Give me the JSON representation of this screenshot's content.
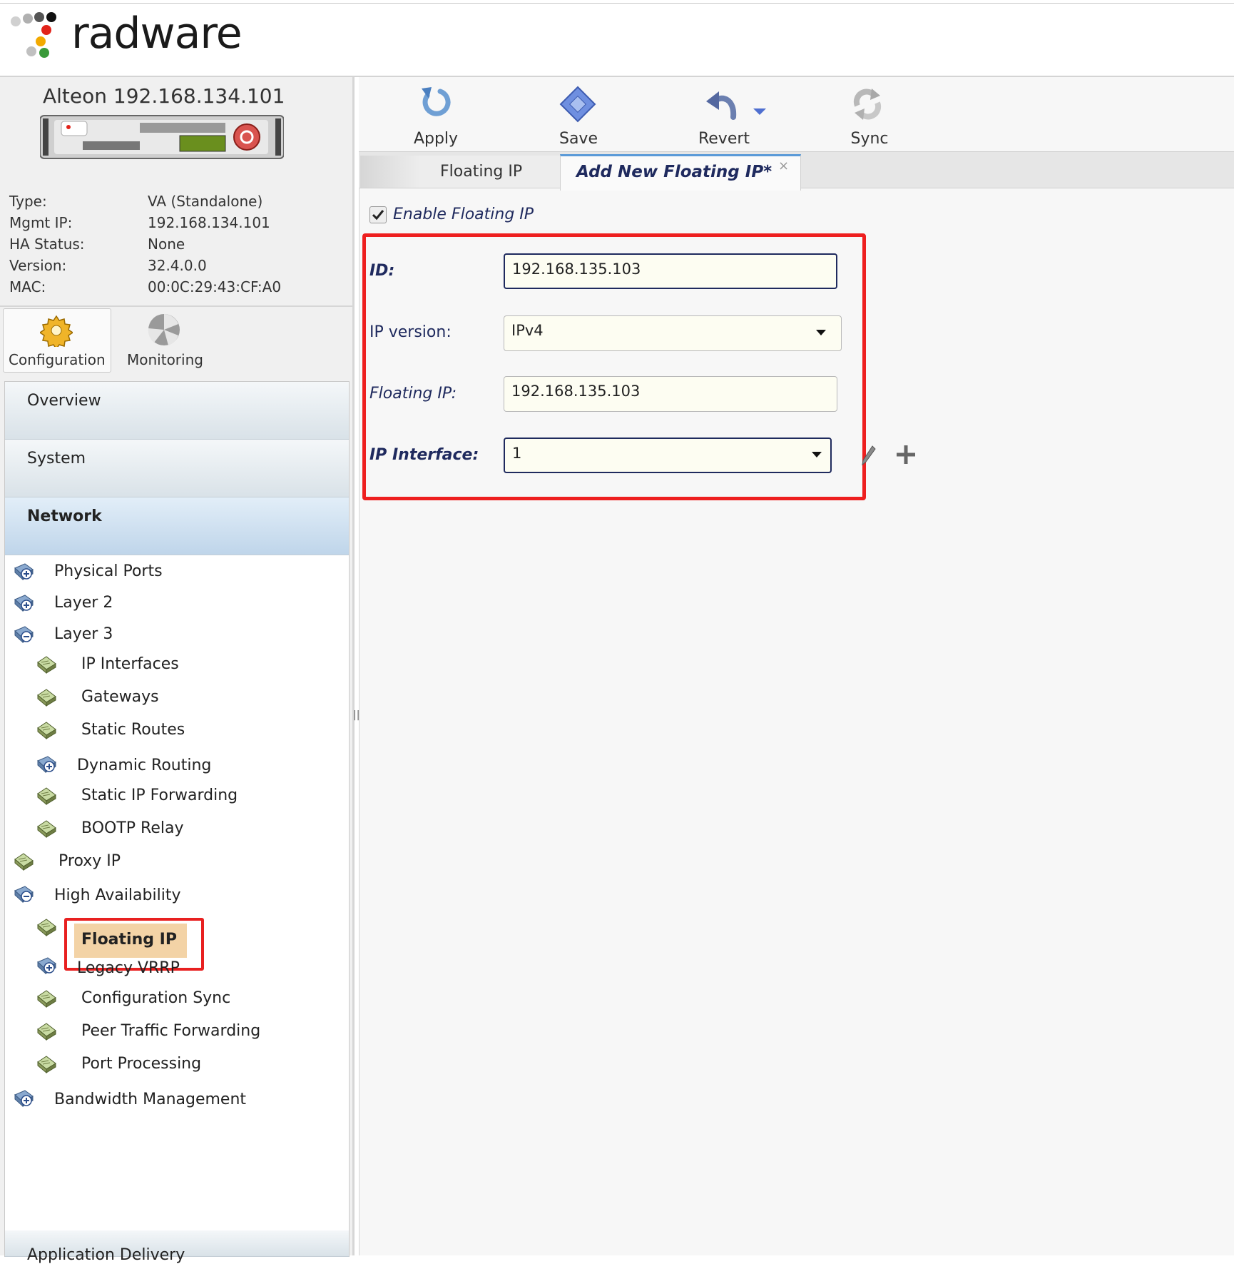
{
  "brand": {
    "logo_text": "radware"
  },
  "device": {
    "title": "Alteon 192.168.134.101",
    "info": [
      {
        "label": "Type:",
        "value": "VA (Standalone)"
      },
      {
        "label": "Mgmt IP:",
        "value": "192.168.134.101"
      },
      {
        "label": "HA Status:",
        "value": "None"
      },
      {
        "label": "Version:",
        "value": "32.4.0.0"
      },
      {
        "label": "MAC:",
        "value": "00:0C:29:43:CF:A0"
      }
    ]
  },
  "perspective_tabs": {
    "configuration": "Configuration",
    "monitoring": "Monitoring"
  },
  "nav": {
    "sections": {
      "overview": "Overview",
      "system": "System",
      "network": "Network",
      "app_delivery": "Application Delivery"
    },
    "items": {
      "physical_ports": "Physical Ports",
      "layer2": "Layer 2",
      "layer3": "Layer 3",
      "ip_interfaces": "IP Interfaces",
      "gateways": "Gateways",
      "static_routes": "Static Routes",
      "dynamic_routing": "Dynamic Routing",
      "static_ip_forwarding": "Static IP Forwarding",
      "bootp_relay": "BOOTP Relay",
      "proxy_ip": "Proxy IP",
      "high_availability": "High Availability",
      "floating_ip": "Floating IP",
      "legacy_vrrp": "Legacy VRRP",
      "config_sync": "Configuration Sync",
      "peer_traffic_forwarding": "Peer Traffic Forwarding",
      "port_processing": "Port Processing",
      "bandwidth_management": "Bandwidth Management"
    },
    "selected": "Floating IP"
  },
  "toolbar": {
    "apply": "Apply",
    "save": "Save",
    "revert": "Revert",
    "sync": "Sync"
  },
  "tabs": {
    "list": "Floating IP",
    "add_new": "Add New Floating IP*",
    "close": "×"
  },
  "form": {
    "enable_label": "Enable Floating IP",
    "enable_checked": true,
    "id_label": "ID:",
    "id_value": "192.168.135.103",
    "ip_version_label": "IP version:",
    "ip_version_value": "IPv4",
    "floating_ip_label": "Floating IP:",
    "floating_ip_value": "192.168.135.103",
    "ip_interface_label": "IP Interface:",
    "ip_interface_value": "1"
  },
  "colors": {
    "highlight_box": "#ee1f1f",
    "selected_item_bg": "#f3d3a6",
    "label_navy": "#1f2a5e"
  }
}
